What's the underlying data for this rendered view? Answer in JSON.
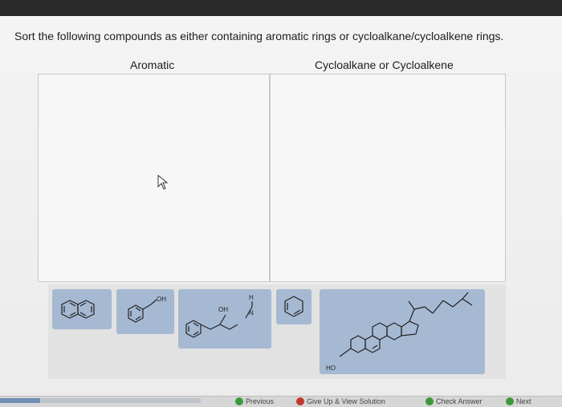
{
  "question": {
    "instructions": "Sort the following compounds as either containing aromatic rings or cycloalkane/cycloalkene rings."
  },
  "bins": [
    {
      "title": "Aromatic"
    },
    {
      "title": "Cycloalkane or Cycloalkene"
    }
  ],
  "compounds": [
    {
      "icon": "naphthalene-structure"
    },
    {
      "icon": "benzyl-alcohol-structure",
      "label": "OH"
    },
    {
      "icon": "amino-alcohol-structure",
      "label_oh": "OH",
      "label_h": "H",
      "label_n": "N"
    },
    {
      "icon": "cyclohexadiene-structure"
    },
    {
      "icon": "steroid-structure",
      "label": "HO"
    }
  ],
  "footer": {
    "progress": 0.2,
    "previous_label": "Previous",
    "give_up_label": "Give Up & View Solution",
    "check_answer_label": "Check Answer",
    "next_label": "Next",
    "colors": {
      "previous": "#3c9a3c",
      "give_up": "#c0392b",
      "check": "#3c9a3c",
      "next": "#3c9a3c"
    }
  }
}
